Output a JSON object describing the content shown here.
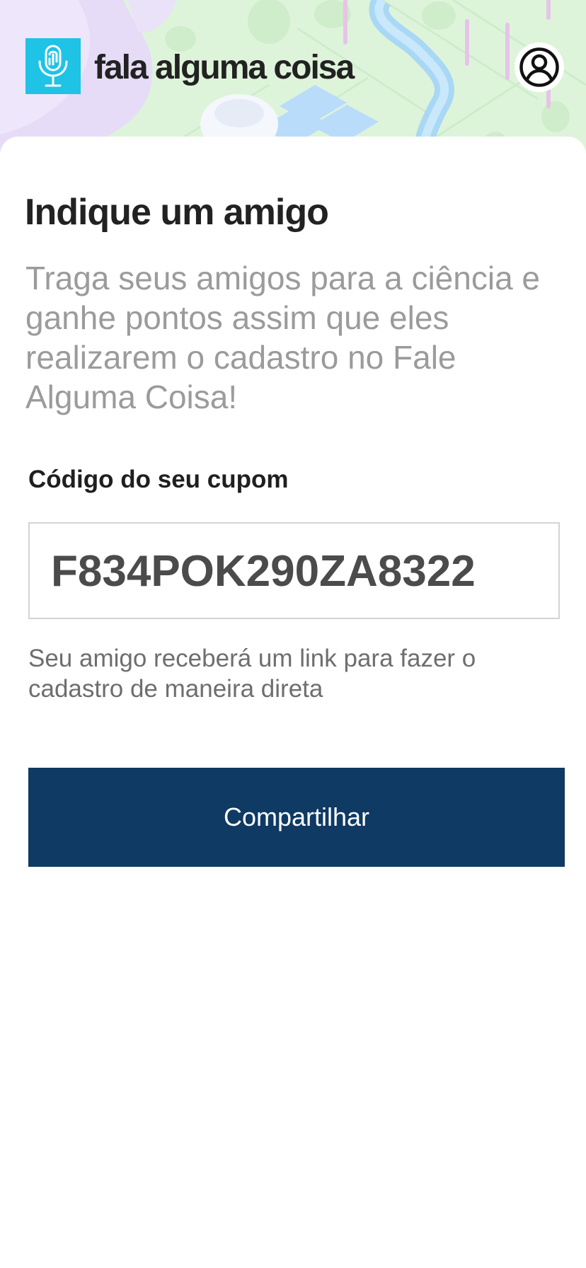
{
  "header": {
    "brand_name": "fala alguma coisa",
    "logo_icon": "microphone-fingerprint-icon",
    "profile_icon": "user-circle-icon",
    "accent_color": "#1ec3e6"
  },
  "main": {
    "title": "Indique um amigo",
    "subtitle": "Traga seus amigos para a ciência e ganhe pontos assim que eles realizarem o cadastro no Fale Alguma Coisa!",
    "coupon_label": "Código do seu cupom",
    "coupon_code": "F834POK290ZA8322",
    "helper_text": "Seu amigo receberá um link para fazer o cadastro de maneira direta",
    "share_button_label": "Compartilhar",
    "share_button_color": "#0e3a64"
  }
}
